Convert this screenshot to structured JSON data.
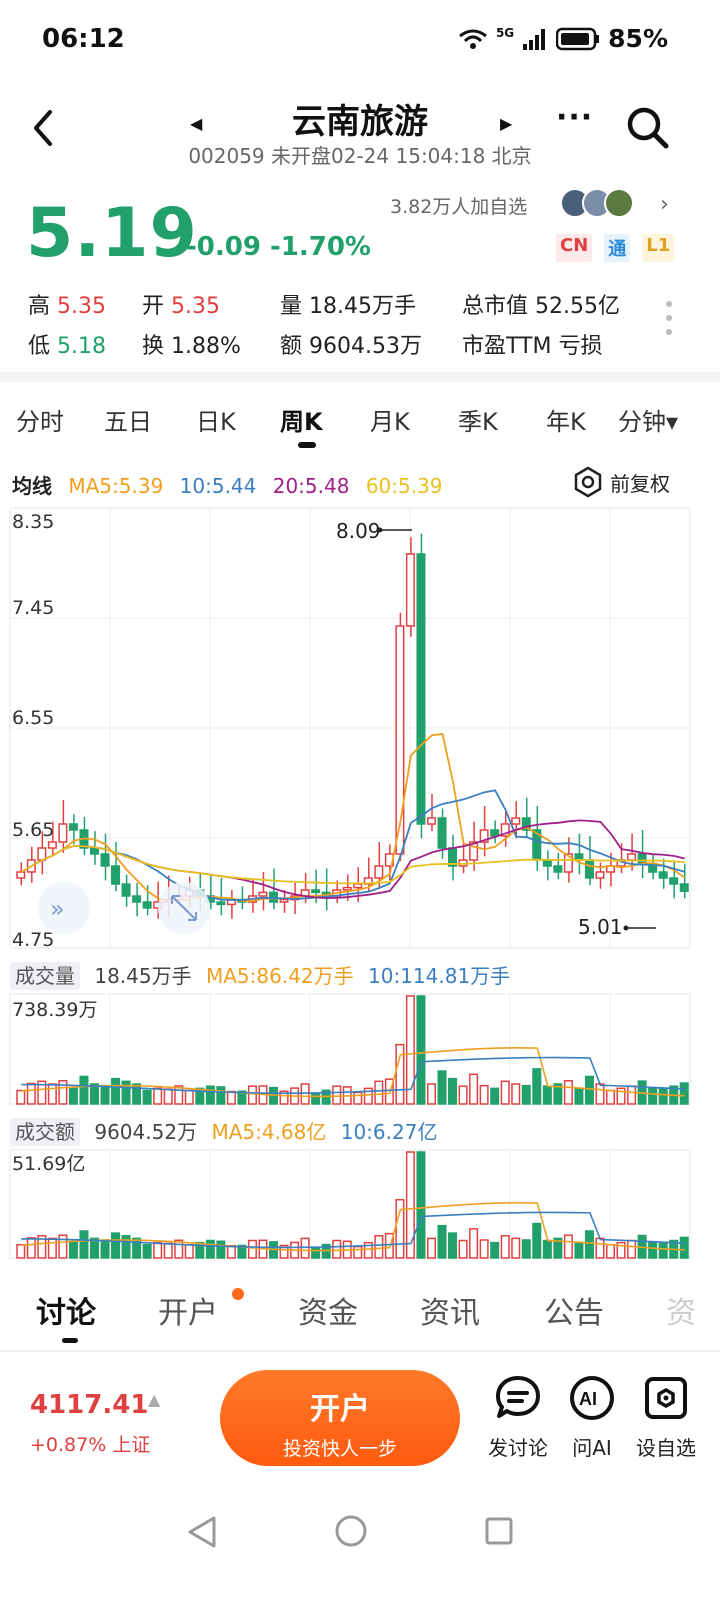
{
  "status": {
    "time": "06:12",
    "network": "5G",
    "battery": "85%"
  },
  "header": {
    "title": "云南旅游",
    "subtitle": "002059 未开盘02-24 15:04:18 北京"
  },
  "quote": {
    "price": "5.19",
    "change": "-0.09 -1.70%",
    "watchers": "3.82万人加自选",
    "badges": [
      "CN",
      "通",
      "L1"
    ],
    "high_label": "高",
    "high": "5.35",
    "open_label": "开",
    "open": "5.35",
    "volume_label": "量",
    "volume": "18.45万手",
    "mcap_label": "总市值",
    "mcap": "52.55亿",
    "low_label": "低",
    "low": "5.18",
    "turnover_label": "换",
    "turnover": "1.88%",
    "amount_label": "额",
    "amount": "9604.53万",
    "pe_label": "市盈TTM",
    "pe": "亏损"
  },
  "period_tabs": [
    "分时",
    "五日",
    "日K",
    "周K",
    "月K",
    "季K",
    "年K",
    "分钟▾"
  ],
  "active_period": "周K",
  "ma": {
    "label": "均线",
    "ma5": "MA5:5.39",
    "ma10": "10:5.44",
    "ma20": "20:5.48",
    "ma60": "60:5.39",
    "adjust": "前复权"
  },
  "colors": {
    "up": "#e04040",
    "down": "#21a06b",
    "ma5": "#f0a020",
    "ma10": "#3a7fc0",
    "ma20": "#a0208a",
    "ma60": "#e8c020",
    "accent": "#ff6a1a"
  },
  "price_axis": [
    "8.35",
    "7.45",
    "6.55",
    "5.65",
    "4.75"
  ],
  "price_markers": {
    "high": "8.09",
    "low": "5.01"
  },
  "volume": {
    "label": "成交量",
    "value": "18.45万手",
    "ma5": "MA5:86.42万手",
    "ma10": "10:114.81万手",
    "axis_max": "738.39万"
  },
  "amount": {
    "label": "成交额",
    "value": "9604.52万",
    "ma5": "MA5:4.68亿",
    "ma10": "10:6.27亿",
    "axis_max": "51.69亿"
  },
  "bottom_tabs": [
    "讨论",
    "开户",
    "资金",
    "资讯",
    "公告",
    "资"
  ],
  "footer": {
    "index_value": "4117.41",
    "index_sub": "+0.87% 上证",
    "open_button": "开户",
    "open_button_sub": "投资快人一步",
    "discuss": "发讨论",
    "ask_ai": "问AI",
    "set_watch": "设自选"
  }
}
